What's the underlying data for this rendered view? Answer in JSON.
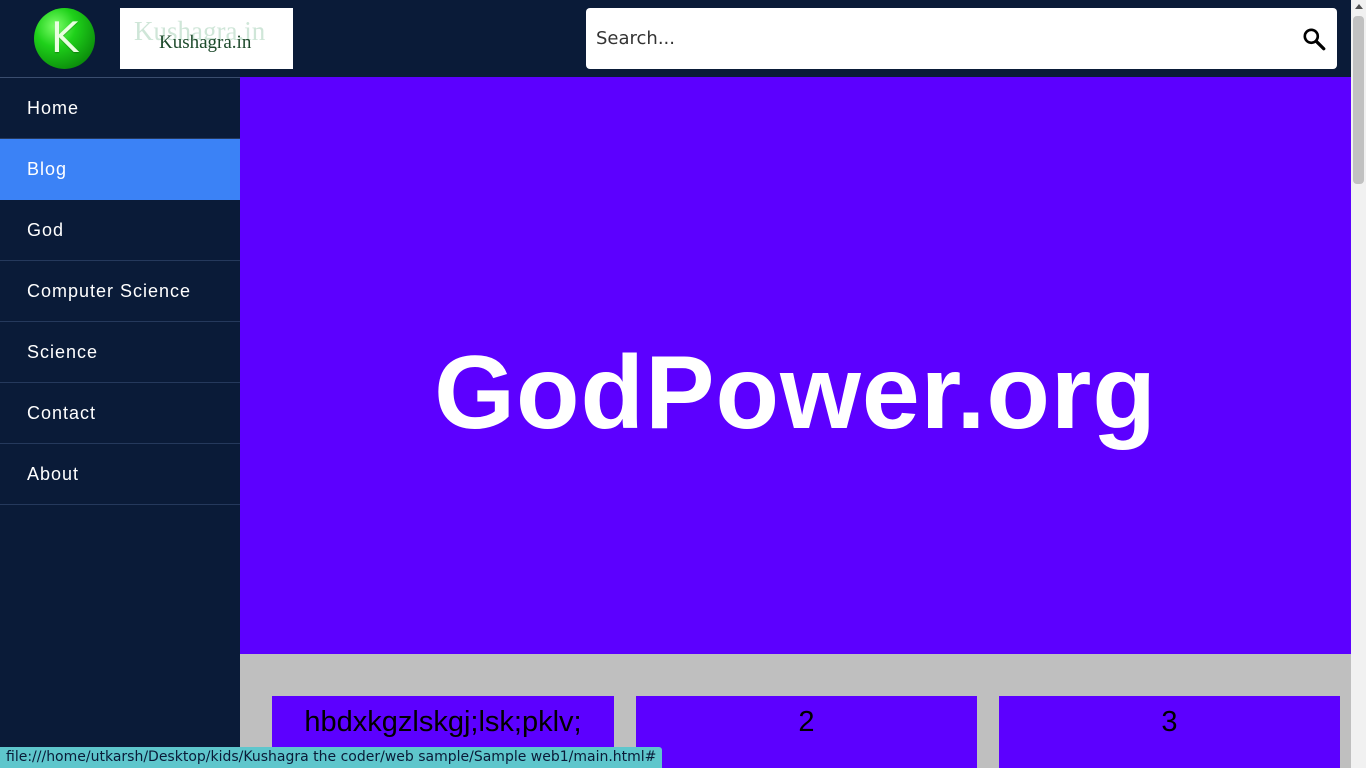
{
  "header": {
    "logo_letter": "K",
    "logo_text_ghost": "Kushagra.in",
    "logo_text": "Kushagra.in",
    "search_placeholder": "Search...",
    "search_icon": "search-icon"
  },
  "sidebar": {
    "items": [
      {
        "label": "Home"
      },
      {
        "label": "Blog"
      },
      {
        "label": "God"
      },
      {
        "label": "Computer Science"
      },
      {
        "label": "Science"
      },
      {
        "label": "Contact"
      },
      {
        "label": "About"
      }
    ],
    "active": "Blog"
  },
  "hero": {
    "title": "GodPower.org"
  },
  "cards": [
    {
      "text": "hbdxkgzlskgj;lsk;pklv;"
    },
    {
      "text": "2"
    },
    {
      "text": "3"
    }
  ],
  "statusbar": {
    "url": "file:///home/utkarsh/Desktop/kids/Kushagra the coder/web sample/Sample web1/main.html#"
  },
  "colors": {
    "header_bg": "#0a1b38",
    "accent_active": "#3b82f6",
    "hero_bg": "#5c00ff",
    "cards_area_bg": "#bfbfbf",
    "statusbar_bg": "#5ec6cc"
  }
}
